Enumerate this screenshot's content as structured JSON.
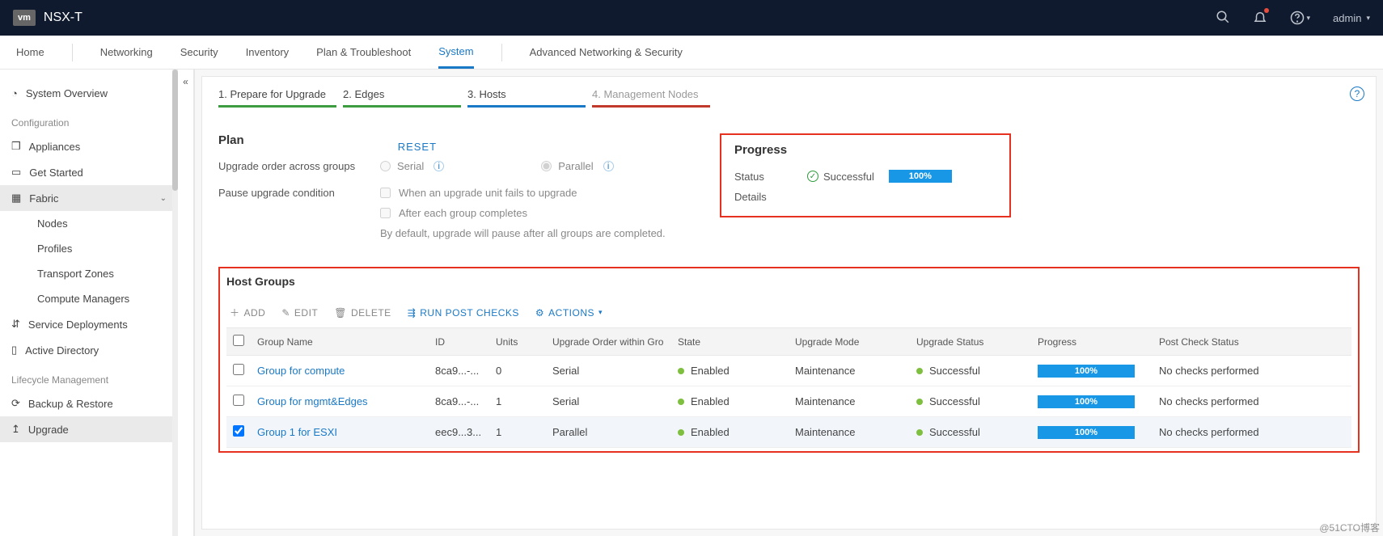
{
  "brand": {
    "logo_text": "vm",
    "product": "NSX-T"
  },
  "topbar": {
    "user": "admin"
  },
  "tabs": {
    "home": "Home",
    "networking": "Networking",
    "security": "Security",
    "inventory": "Inventory",
    "plan_ts": "Plan & Troubleshoot",
    "system": "System",
    "adv": "Advanced Networking & Security"
  },
  "sidebar": {
    "overview": "System Overview",
    "config_header": "Configuration",
    "appliances": "Appliances",
    "get_started": "Get Started",
    "fabric": "Fabric",
    "nodes": "Nodes",
    "profiles": "Profiles",
    "tzones": "Transport Zones",
    "cmgr": "Compute Managers",
    "svc_depl": "Service Deployments",
    "ad": "Active Directory",
    "lifecycle_header": "Lifecycle Management",
    "backup": "Backup & Restore",
    "upgrade": "Upgrade"
  },
  "steps": {
    "s1": "1. Prepare for Upgrade",
    "s2": "2. Edges",
    "s3": "3. Hosts",
    "s4": "4. Management Nodes"
  },
  "plan": {
    "title": "Plan",
    "reset": "RESET",
    "order_label": "Upgrade order across groups",
    "serial": "Serial",
    "parallel": "Parallel",
    "pause_label": "Pause upgrade condition",
    "cond1": "When an upgrade unit fails to upgrade",
    "cond2": "After each group completes",
    "note": "By default, upgrade will pause after all groups are completed."
  },
  "progress": {
    "title": "Progress",
    "status_label": "Status",
    "status_value": "Successful",
    "details_label": "Details",
    "percent": "100%"
  },
  "hostgroups": {
    "title": "Host Groups",
    "add": "ADD",
    "edit": "EDIT",
    "delete": "DELETE",
    "run_checks": "RUN POST CHECKS",
    "actions": "ACTIONS",
    "cols": {
      "name": "Group Name",
      "id": "ID",
      "units": "Units",
      "order": "Upgrade Order within Gro",
      "state": "State",
      "mode": "Upgrade Mode",
      "ustatus": "Upgrade Status",
      "progress": "Progress",
      "post": "Post Check Status"
    },
    "rows": [
      {
        "checked": false,
        "name": "Group for compute",
        "id": "8ca9...-...",
        "units": "0",
        "order": "Serial",
        "state": "Enabled",
        "mode": "Maintenance",
        "ustatus": "Successful",
        "progress": "100%",
        "post": "No checks performed"
      },
      {
        "checked": false,
        "name": "Group for mgmt&Edges",
        "id": "8ca9...-...",
        "units": "1",
        "order": "Serial",
        "state": "Enabled",
        "mode": "Maintenance",
        "ustatus": "Successful",
        "progress": "100%",
        "post": "No checks performed"
      },
      {
        "checked": true,
        "name": "Group 1  for ESXI",
        "id": "eec9...3...",
        "units": "1",
        "order": "Parallel",
        "state": "Enabled",
        "mode": "Maintenance",
        "ustatus": "Successful",
        "progress": "100%",
        "post": "No checks performed"
      }
    ]
  },
  "watermark": "@51CTO博客"
}
